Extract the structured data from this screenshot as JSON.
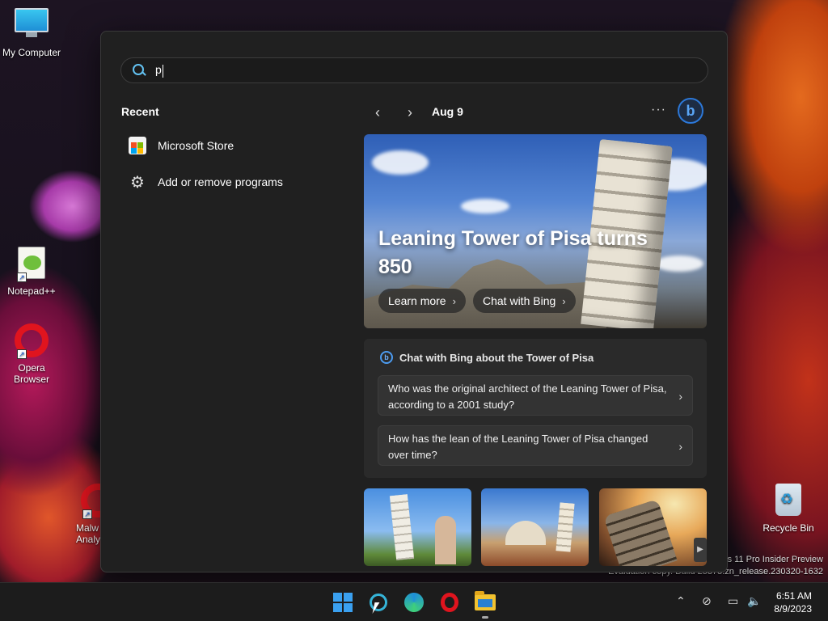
{
  "desktop": {
    "icons": [
      {
        "label": "My Computer"
      },
      {
        "label": "Notepad++"
      },
      {
        "label": "Opera Browser"
      },
      {
        "label": "Malw Analy"
      },
      {
        "label": "Recycle Bin"
      }
    ],
    "watermark_line1": "s 11 Pro Insider Preview",
    "watermark_line2": "Evaluation copy. Build 25375.zn_release.230320-1632"
  },
  "search": {
    "query": "p"
  },
  "recent": {
    "title": "Recent",
    "items": [
      {
        "label": "Microsoft Store",
        "icon": "microsoft-store-icon"
      },
      {
        "label": "Add or remove programs",
        "icon": "gear-icon"
      }
    ]
  },
  "feed": {
    "date": "Aug 9",
    "more_label": "···",
    "hero": {
      "title": "Leaning Tower of Pisa turns 850",
      "learn_more": "Learn more",
      "chat_with_bing": "Chat with Bing"
    },
    "chat": {
      "heading": "Chat with Bing about the Tower of Pisa",
      "questions": [
        "Who was the original architect of the Leaning Tower of Pisa, according to a 2001 study?",
        "How has the lean of the Leaning Tower of Pisa changed over time?"
      ]
    }
  },
  "taskbar": {
    "clock_time": "6:51 AM",
    "clock_date": "8/9/2023"
  },
  "colors": {
    "panel_bg": "#202020",
    "accent": "#3aa0f0"
  }
}
